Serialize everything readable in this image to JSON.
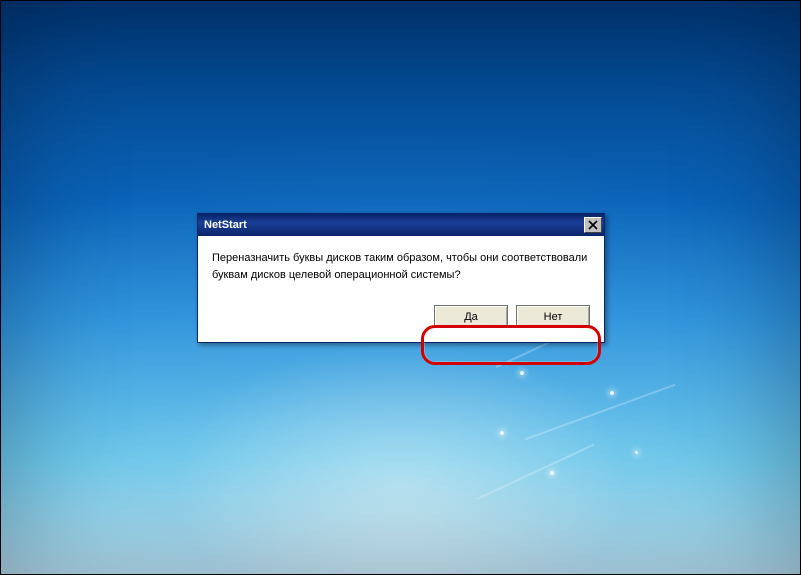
{
  "dialog": {
    "title": "NetStart",
    "message": "Переназначить буквы дисков таким образом, чтобы они соответствовали буквам дисков целевой операционной системы?",
    "yes_label": "Да",
    "no_label": "Нет",
    "close_icon": "close-icon"
  },
  "colors": {
    "titlebar": "#0a246a",
    "highlight": "#d40000"
  }
}
